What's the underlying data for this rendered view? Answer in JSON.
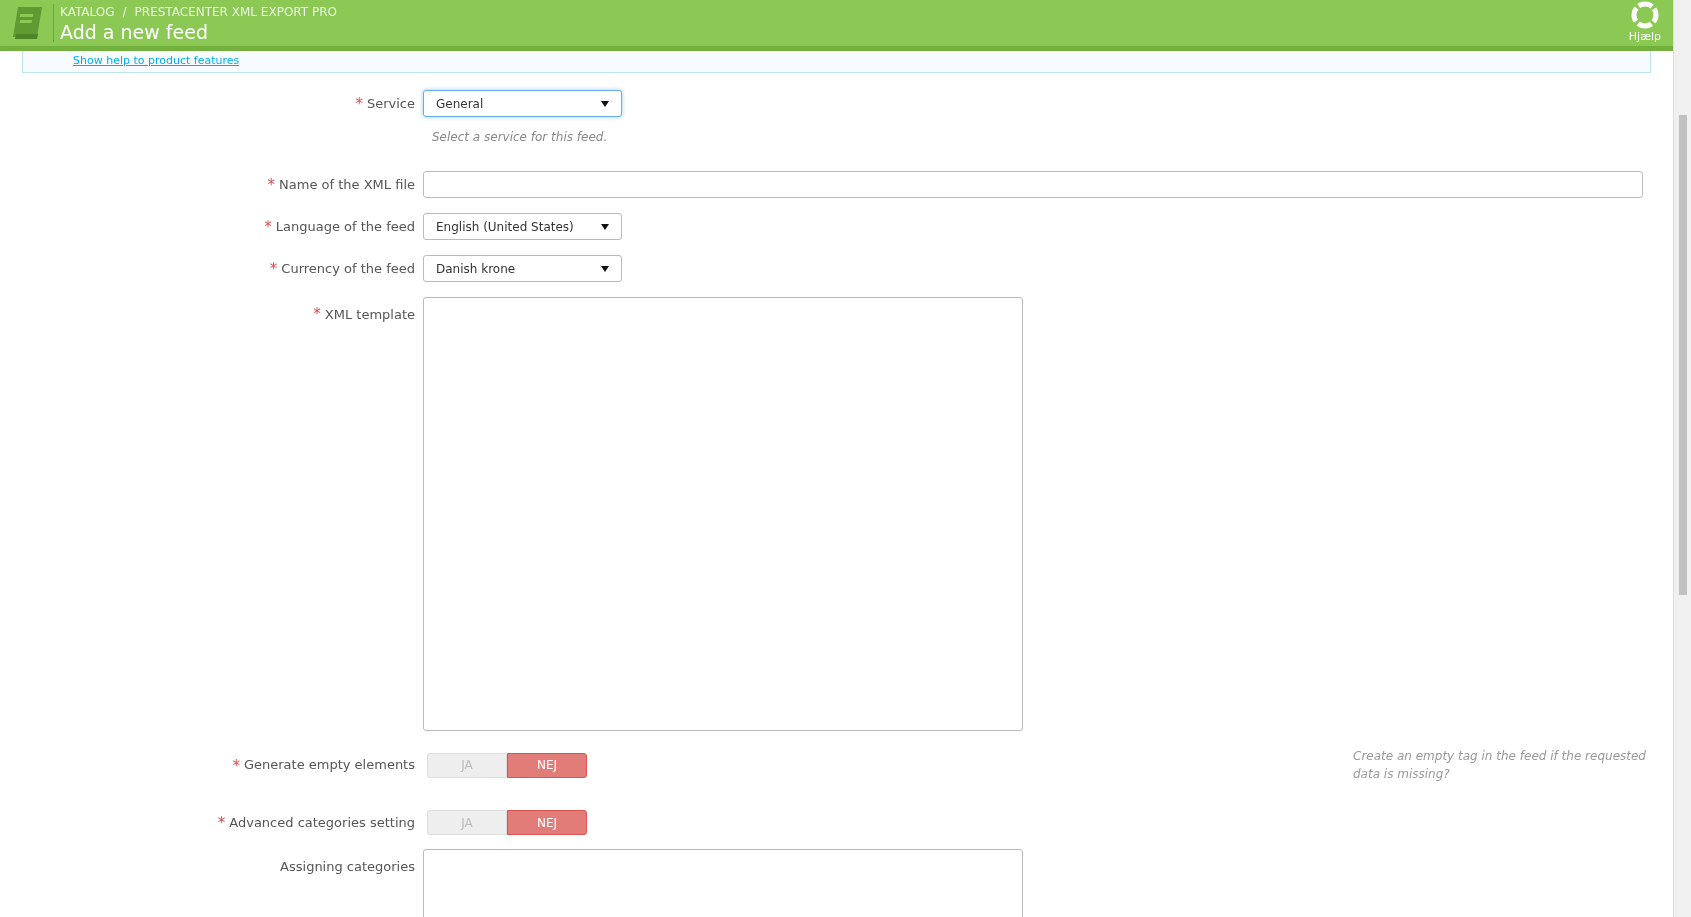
{
  "header": {
    "breadcrumb": [
      "KATALOG",
      "PRESTACENTER XML EXPORT PRO"
    ],
    "separator": "/",
    "title": "Add a new feed",
    "help": "Hjælp"
  },
  "info_link": "Show help to product features",
  "fields": [
    {
      "kind": "select",
      "label": "Service",
      "required_mark": "*",
      "value": "General",
      "focused": true,
      "hint": "Select a service for this feed."
    },
    {
      "kind": "text",
      "label": "Name of the XML file",
      "required_mark": "*"
    },
    {
      "kind": "select",
      "label": "Language of the feed",
      "required_mark": "*",
      "value": "English (United States)",
      "focused": false
    },
    {
      "kind": "select",
      "label": "Currency of the feed",
      "required_mark": "*",
      "value": "Danish krone",
      "focused": false
    },
    {
      "kind": "textarea",
      "label": "XML template",
      "required_mark": "*"
    },
    {
      "kind": "toggle",
      "label": "Generate empty elements",
      "required_mark": "*",
      "options": [
        {
          "label": "JA",
          "selected": false
        },
        {
          "label": "NEJ",
          "selected": true
        }
      ],
      "side_hint": "Create an empty tag in the feed if the requested data is missing?"
    },
    {
      "kind": "toggle",
      "label": "Advanced categories setting",
      "required_mark": "*",
      "options": [
        {
          "label": "JA",
          "selected": false
        },
        {
          "label": "NEJ",
          "selected": true
        }
      ]
    },
    {
      "kind": "textarea_cut",
      "label": "Assigning categories"
    }
  ]
}
